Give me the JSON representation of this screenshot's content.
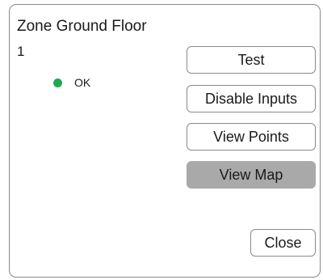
{
  "zone": {
    "title": "Zone Ground Floor",
    "number": "1",
    "status_text": "OK",
    "status_color": "#1daa54"
  },
  "buttons": {
    "test": "Test",
    "disable_inputs": "Disable Inputs",
    "view_points": "View Points",
    "view_map": "View Map",
    "close": "Close"
  },
  "colors": {
    "active_button": "#a9a9a9",
    "border": "#8a8a8a"
  }
}
